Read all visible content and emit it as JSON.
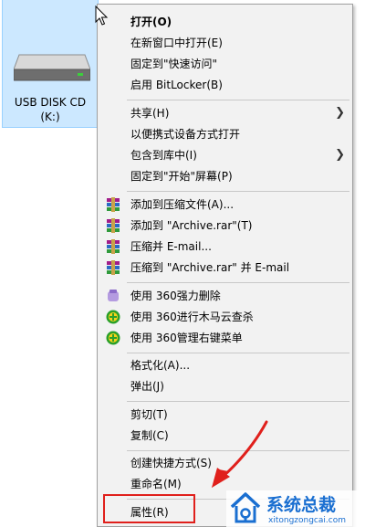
{
  "drive": {
    "name": "USB DISK CD",
    "letter": "(K:)"
  },
  "menu": {
    "items": [
      {
        "label": "打开(O)",
        "bold": true
      },
      {
        "label": "在新窗口中打开(E)"
      },
      {
        "label": "固定到\"快速访问\""
      },
      {
        "label": "启用 BitLocker(B)"
      },
      {
        "label": "共享(H)",
        "submenu": true
      },
      {
        "label": "以便携式设备方式打开"
      },
      {
        "label": "包含到库中(I)",
        "submenu": true
      },
      {
        "label": "固定到\"开始\"屏幕(P)"
      },
      {
        "label": "添加到压缩文件(A)...",
        "icon": "winrar-icon"
      },
      {
        "label": "添加到 \"Archive.rar\"(T)",
        "icon": "winrar-icon"
      },
      {
        "label": "压缩并 E-mail...",
        "icon": "winrar-icon"
      },
      {
        "label": "压缩到 \"Archive.rar\" 并 E-mail",
        "icon": "winrar-icon"
      },
      {
        "label": "使用 360强力删除",
        "icon": "360-shred-icon"
      },
      {
        "label": "使用 360进行木马云查杀",
        "icon": "360-guard-icon"
      },
      {
        "label": "使用 360管理右键菜单",
        "icon": "360-guard-icon"
      },
      {
        "label": "格式化(A)..."
      },
      {
        "label": "弹出(J)"
      },
      {
        "label": "剪切(T)"
      },
      {
        "label": "复制(C)"
      },
      {
        "label": "创建快捷方式(S)"
      },
      {
        "label": "重命名(M)"
      },
      {
        "label": "属性(R)"
      }
    ]
  },
  "watermark": {
    "title": "系统总裁",
    "url": "xitongzongcai.com"
  },
  "colors": {
    "selection": "#cce8ff",
    "menu_bg": "#f2f2f2",
    "annotation": "#e0201c",
    "watermark_blue": "#1a6fd1"
  }
}
